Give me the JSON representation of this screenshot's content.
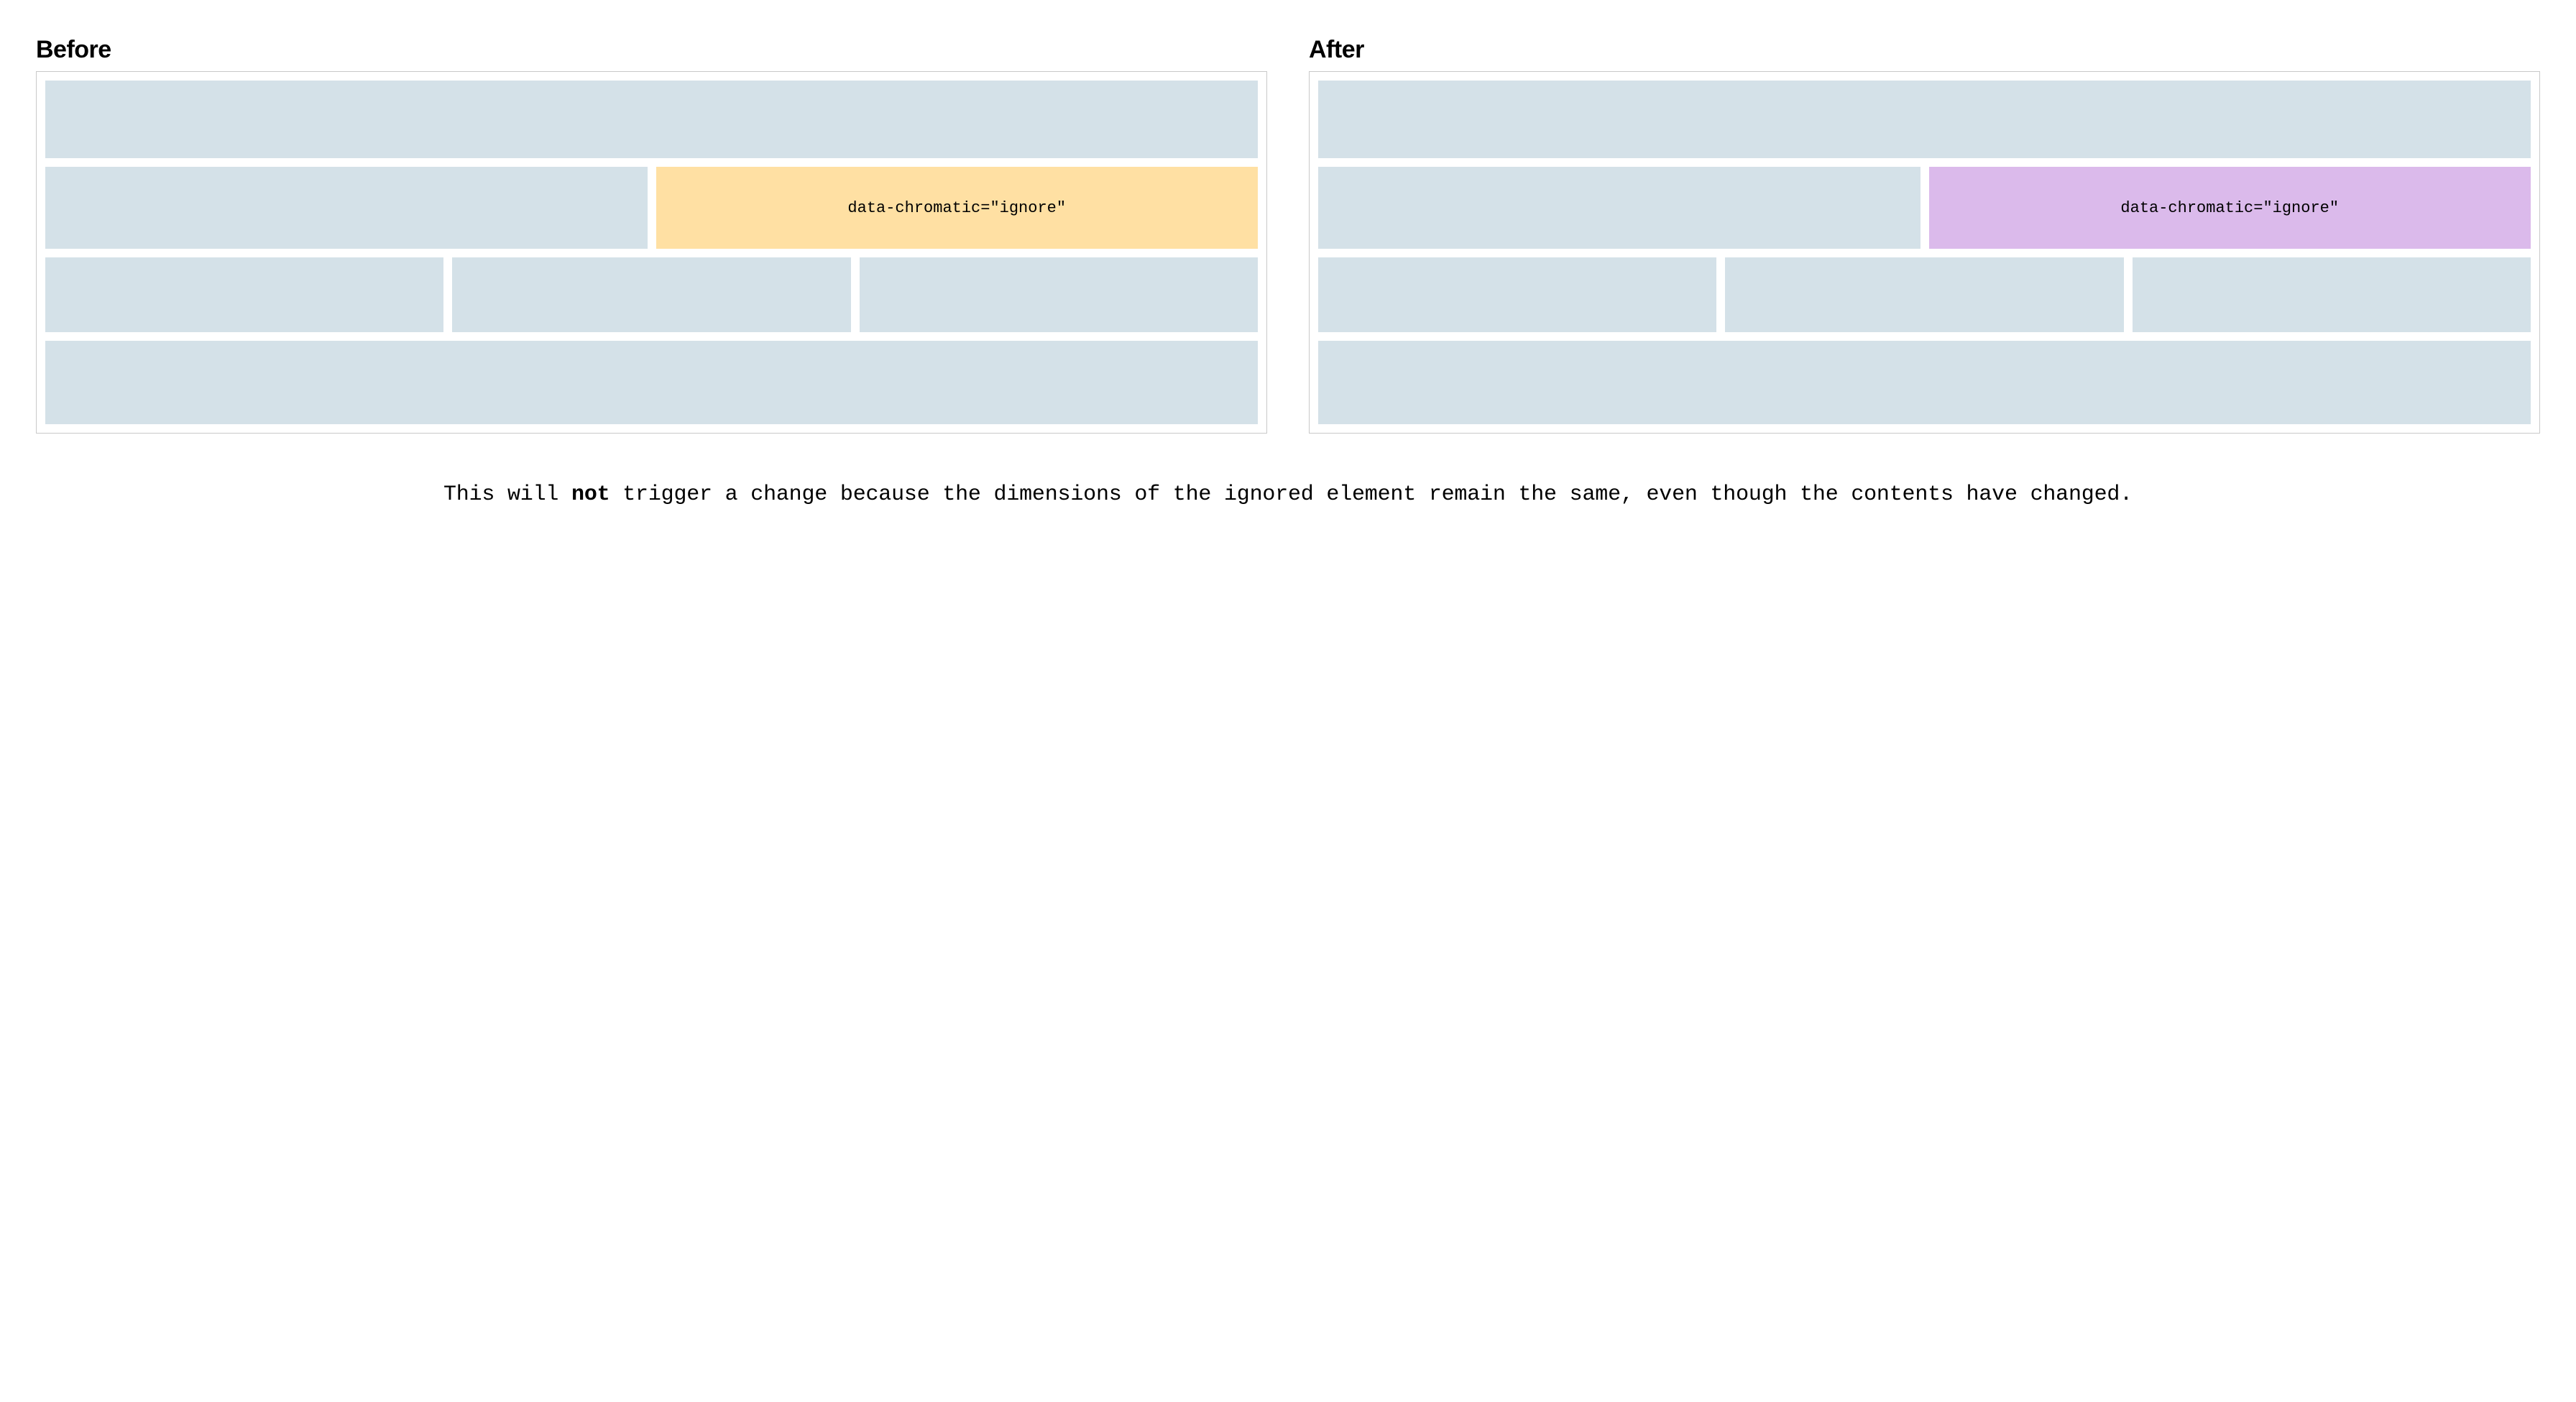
{
  "before": {
    "heading": "Before",
    "highlight_text": "data-chromatic=\"ignore\"",
    "highlight_color": "#ffe0a3"
  },
  "after": {
    "heading": "After",
    "highlight_text": "data-chromatic=\"ignore\"",
    "highlight_color": "#dbbaeb"
  },
  "caption": {
    "pre": "This will ",
    "bold": "not",
    "post": " trigger a change because the dimensions of the ignored element remain the same, even though the contents have changed."
  },
  "colors": {
    "block": "#d4e1e8",
    "frame_border": "#c9c9c9"
  }
}
